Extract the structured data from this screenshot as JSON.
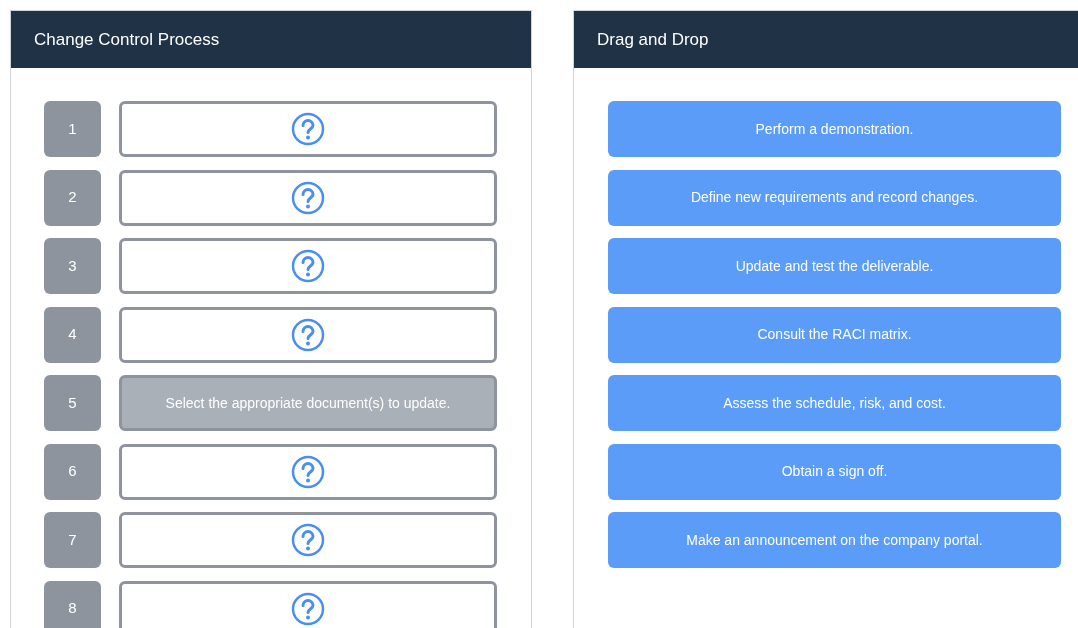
{
  "process_panel": {
    "title": "Change Control Process",
    "slots": [
      {
        "number": "1",
        "kind": "empty"
      },
      {
        "number": "2",
        "kind": "empty"
      },
      {
        "number": "3",
        "kind": "empty"
      },
      {
        "number": "4",
        "kind": "empty"
      },
      {
        "number": "5",
        "kind": "filled",
        "text": "Select the appropriate document(s) to update."
      },
      {
        "number": "6",
        "kind": "empty"
      },
      {
        "number": "7",
        "kind": "empty"
      },
      {
        "number": "8",
        "kind": "empty"
      }
    ]
  },
  "drag_panel": {
    "title": "Drag and Drop",
    "items": [
      "Perform a demonstration.",
      "Define new requirements and record changes.",
      "Update and test the deliverable.",
      "Consult the RACI matrix.",
      "Assess the schedule, risk, and cost.",
      "Obtain a sign off.",
      "Make an announcement on the company portal."
    ]
  }
}
